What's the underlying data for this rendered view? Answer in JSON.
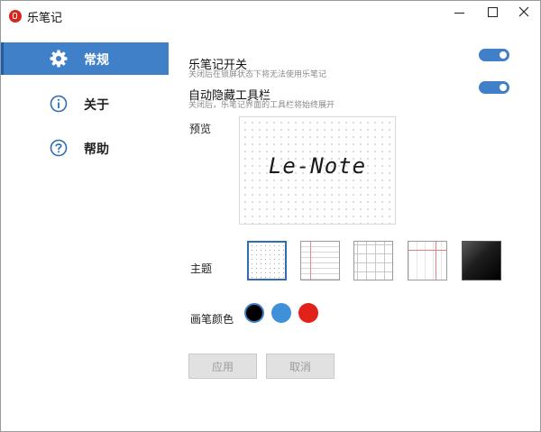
{
  "window": {
    "title": "乐笔记"
  },
  "sidebar": {
    "items": [
      {
        "label": "常规",
        "icon": "gear-icon",
        "active": true
      },
      {
        "label": "关于",
        "icon": "info-icon",
        "active": false
      },
      {
        "label": "帮助",
        "icon": "help-icon",
        "active": false
      }
    ]
  },
  "settings": {
    "switch": {
      "title": "乐笔记开关",
      "desc": "关闭后在锁屏状态下将无法使用乐笔记",
      "on": true
    },
    "auto_hide": {
      "title": "自动隐藏工具栏",
      "desc": "关闭后，乐笔记界面的工具栏将始终展开",
      "on": true
    },
    "preview": {
      "label": "预览",
      "sample_text": "Le-Note"
    },
    "theme": {
      "label": "主题",
      "options": [
        "dot-grid",
        "ruled-lines",
        "square-grid",
        "red-margin",
        "dark"
      ],
      "selected_index": 0
    },
    "pen_color": {
      "label": "画笔颜色",
      "colors": [
        "#000000",
        "#3f90d9",
        "#e3211b"
      ],
      "selected_index": 0
    }
  },
  "actions": {
    "apply_label": "应用",
    "cancel_label": "取消"
  },
  "colors": {
    "accent": "#3f80c9",
    "logo": "#d9251c"
  }
}
